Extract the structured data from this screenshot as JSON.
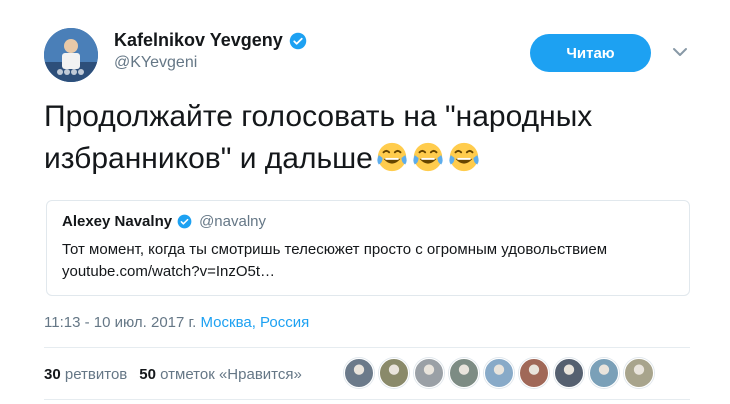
{
  "author": {
    "name": "Kafelnikov Yevgeny",
    "handle": "@KYevgeni"
  },
  "follow_button": {
    "label": "Читаю"
  },
  "tweet": {
    "text_line1": "Продолжайте голосовать на \"народных",
    "text_line2": "избранников\" и дальше",
    "emoji": [
      "face-with-tears-of-joy",
      "face-with-tears-of-joy",
      "face-with-tears-of-joy"
    ]
  },
  "quoted_tweet": {
    "name": "Alexey Navalny",
    "handle": "@navalny",
    "text": "Тот момент, когда ты смотришь телесюжет просто с огромным удовольствием",
    "link": "youtube.com/watch?v=InzO5t…"
  },
  "meta": {
    "time": "11:13 - 10 июл. 2017 г.",
    "location": "Москва, Россия"
  },
  "stats": {
    "retweets_count": "30",
    "retweets_label": "ретвитов",
    "likes_count": "50",
    "likes_label": "отметок «Нравится»"
  },
  "likers": [
    {
      "icon": "liker-avatar",
      "color": "#6b7a8a"
    },
    {
      "icon": "liker-avatar",
      "color": "#8a8a6a"
    },
    {
      "icon": "liker-avatar",
      "color": "#9aa0a6"
    },
    {
      "icon": "liker-avatar",
      "color": "#7d8c84"
    },
    {
      "icon": "liker-avatar",
      "color": "#88aac8"
    },
    {
      "icon": "liker-avatar",
      "color": "#a06858"
    },
    {
      "icon": "liker-avatar",
      "color": "#556070"
    },
    {
      "icon": "liker-avatar",
      "color": "#7aa0b8"
    },
    {
      "icon": "liker-avatar",
      "color": "#a8a48c"
    }
  ],
  "colors": {
    "accent": "#1da1f2",
    "secondary_text": "#657786"
  }
}
